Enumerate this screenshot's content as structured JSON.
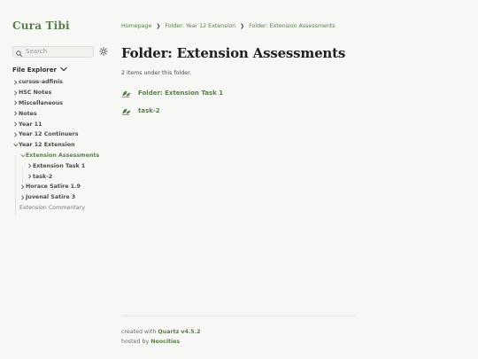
{
  "site": {
    "title": "Cura Tibi"
  },
  "search": {
    "placeholder": "Search"
  },
  "explorer": {
    "title": "File Explorer",
    "items": [
      {
        "label": "cursus-adfinis"
      },
      {
        "label": "HSC Notes"
      },
      {
        "label": "Miscellaneous"
      },
      {
        "label": "Notes"
      },
      {
        "label": "Year 11"
      },
      {
        "label": "Year 12 Continuers"
      },
      {
        "label": "Year 12 Extension"
      },
      {
        "label": "Extension Assessments"
      },
      {
        "label": "Extension Task 1"
      },
      {
        "label": "task-2"
      },
      {
        "label": "Horace Satire 1.9"
      },
      {
        "label": "Juvenal Satire 3"
      },
      {
        "label": "Extension Commentary"
      }
    ]
  },
  "breadcrumb": {
    "home": "Homepage",
    "parent": "Folder: Year 12 Extension",
    "current": "Folder: Extension Assessments",
    "separator": "❯"
  },
  "main": {
    "title": "Folder: Extension Assessments",
    "count_text": "2 items under this folder.",
    "items": [
      {
        "label": "Folder: Extension Task 1"
      },
      {
        "label": "task-2"
      }
    ]
  },
  "footer": {
    "created_prefix": "created with",
    "created_link": "Quartz v4.5.2",
    "hosted_prefix": "hosted by",
    "hosted_link": "Neocities"
  },
  "colors": {
    "accent": "#5b7d4e",
    "background": "#f7f7f5",
    "text": "#2b2b2b"
  },
  "icons": {
    "search": "search-icon",
    "theme": "sun-icon",
    "chevron_right": "chevron-right-icon",
    "chevron_down": "chevron-down-icon",
    "leaf": "leaf-icon"
  }
}
